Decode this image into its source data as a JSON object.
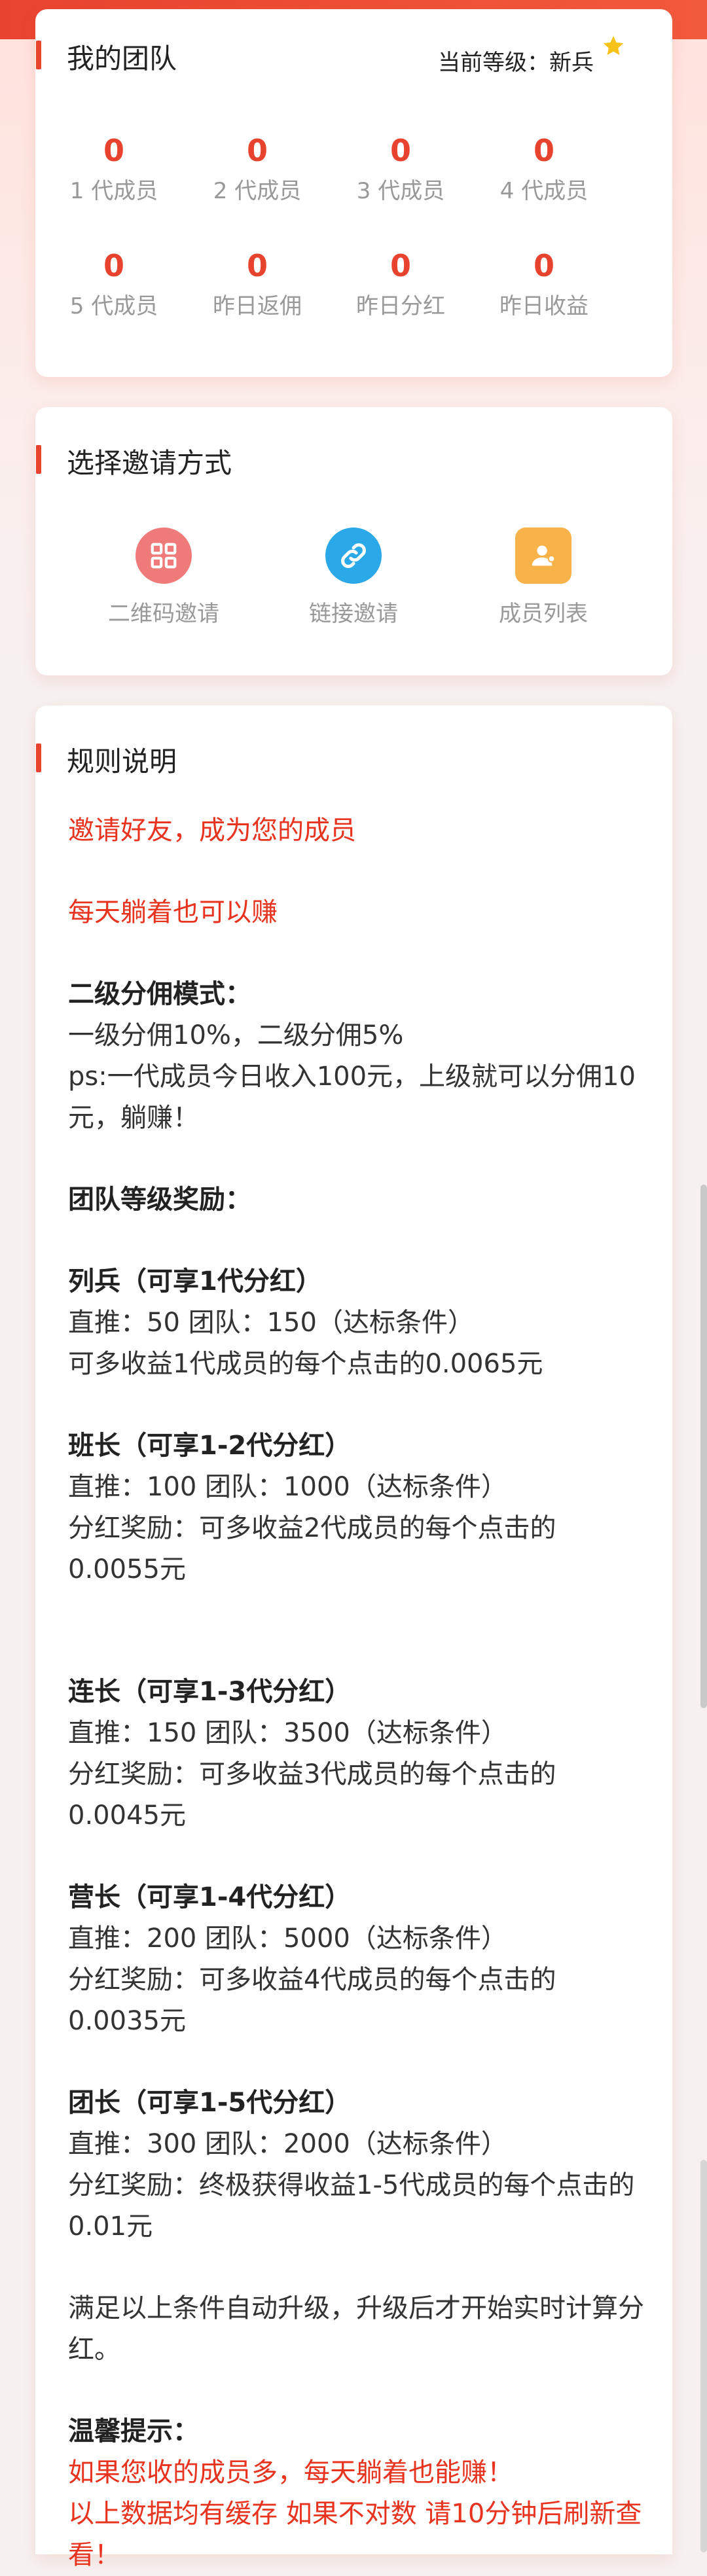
{
  "team": {
    "title": "我的团队",
    "level_label": "当前等级：新兵",
    "stats": [
      {
        "value": "0",
        "label": "1 代成员"
      },
      {
        "value": "0",
        "label": "2 代成员"
      },
      {
        "value": "0",
        "label": "3 代成员"
      },
      {
        "value": "0",
        "label": "4 代成员"
      },
      {
        "value": "0",
        "label": "5 代成员"
      },
      {
        "value": "0",
        "label": "昨日返佣"
      },
      {
        "value": "0",
        "label": "昨日分红"
      },
      {
        "value": "0",
        "label": "昨日收益"
      }
    ]
  },
  "invite": {
    "title": "选择邀请方式",
    "options": [
      {
        "label": "二维码邀请",
        "icon": "qrcode-icon",
        "color": "#ef7a7a"
      },
      {
        "label": "链接邀请",
        "icon": "link-icon",
        "color": "#2aa8e8"
      },
      {
        "label": "成员列表",
        "icon": "members-icon",
        "color": "#f7b24a"
      }
    ]
  },
  "rules": {
    "title": "规则说明",
    "l1": "邀请好友，成为您的成员",
    "l2": "每天躺着也可以赚",
    "l3": "二级分佣模式：",
    "l4": "一级分佣10%，二级分佣5%",
    "l5": "ps:一代成员今日收入100元，上级就可以分佣10元，躺赚！",
    "l6": "团队等级奖励：",
    "r1t": "列兵（可享1代分红）",
    "r1a": "直推：50 团队：150（达标条件）",
    "r1b": "可多收益1代成员的每个点击的0.0065元",
    "r2t": "班长（可享1-2代分红）",
    "r2a": "直推：100 团队：1000（达标条件）",
    "r2b": "分红奖励：可多收益2代成员的每个点击的0.0055元",
    "r3t": "连长（可享1-3代分红）",
    "r3a": "直推：150 团队：3500（达标条件）",
    "r3b": "分红奖励：可多收益3代成员的每个点击的0.0045元",
    "r4t": "营长（可享1-4代分红）",
    "r4a": "直推：200 团队：5000（达标条件）",
    "r4b": "分红奖励：可多收益4代成员的每个点击的0.0035元",
    "r5t": "团长（可享1-5代分红）",
    "r5a": "直推：300 团队：2000（达标条件）",
    "r5b": "分红奖励：终极获得收益1-5代成员的每个点击的0.01元",
    "l7": "满足以上条件自动升级，升级后才开始实时计算分红。",
    "tip": "温馨提示：",
    "tip1": "如果您收的成员多，每天躺着也能赚！",
    "tip2": "以上数据均有缓存 如果不对数 请10分钟后刷新查看！"
  }
}
